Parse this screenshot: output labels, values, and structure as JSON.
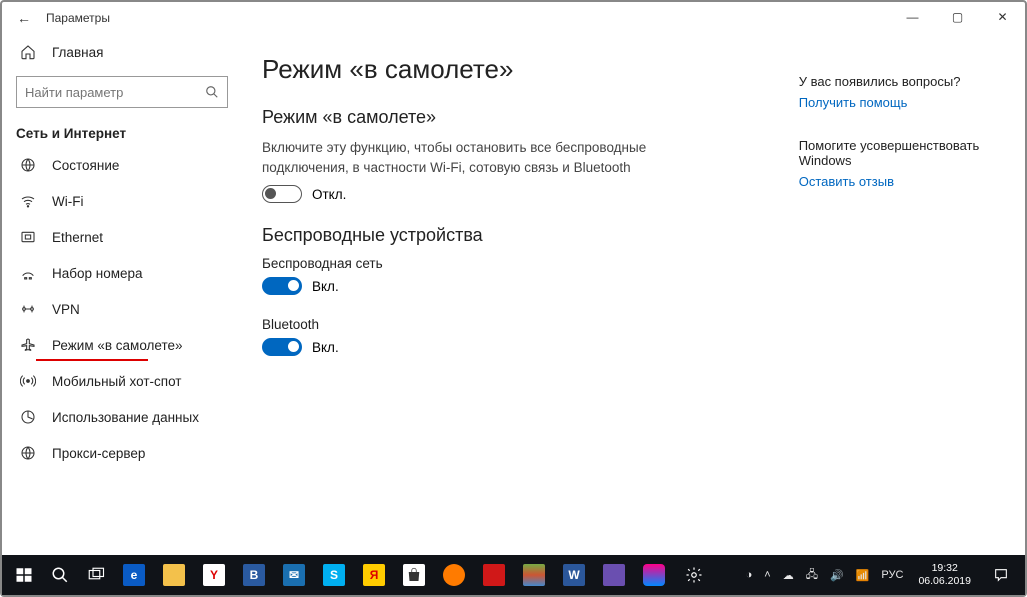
{
  "titlebar": {
    "title": "Параметры"
  },
  "sidebar": {
    "home": "Главная",
    "search_placeholder": "Найти параметр",
    "section": "Сеть и Интернет",
    "items": [
      {
        "label": "Состояние"
      },
      {
        "label": "Wi-Fi"
      },
      {
        "label": "Ethernet"
      },
      {
        "label": "Набор номера"
      },
      {
        "label": "VPN"
      },
      {
        "label": "Режим «в самолете»",
        "active": true
      },
      {
        "label": "Мобильный хот-спот"
      },
      {
        "label": "Использование данных"
      },
      {
        "label": "Прокси-сервер"
      }
    ]
  },
  "main": {
    "page_title": "Режим «в самолете»",
    "s1_title": "Режим «в самолете»",
    "s1_desc": "Включите эту функцию, чтобы остановить все беспроводные подключения, в частности Wi-Fi, сотовую связь и Bluetooth",
    "s1_state": "Откл.",
    "s2_title": "Беспроводные устройства",
    "wireless_label": "Беспроводная сеть",
    "wireless_state": "Вкл.",
    "bt_label": "Bluetooth",
    "bt_state": "Вкл."
  },
  "right": {
    "q_head": "У вас появились вопросы?",
    "q_link": "Получить помощь",
    "fb_head": "Помогите усовершенствовать Windows",
    "fb_link": "Оставить отзыв"
  },
  "taskbar": {
    "lang": "РУС",
    "time": "19:32",
    "date": "06.06.2019"
  }
}
